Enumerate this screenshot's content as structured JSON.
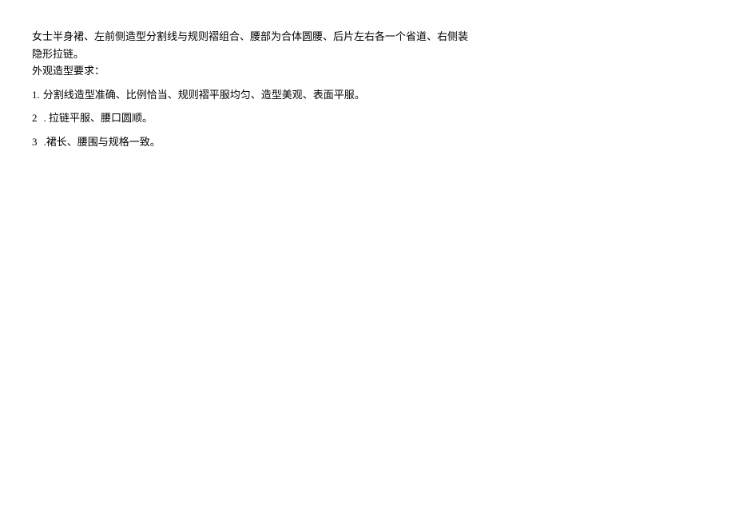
{
  "description": {
    "line1": "女士半身裙、左前侧造型分割线与规则褶组合、腰部为合体圆腰、后片左右各一个省道、右侧装",
    "line2": "隐形拉链。"
  },
  "requirements_title": "外观造型要求：",
  "requirements": [
    {
      "number": "1.",
      "text": "分割线造型准确、比例恰当、规则褶平服均匀、造型美观、表面平服。"
    },
    {
      "number": "2",
      "text": ". 拉链平服、腰口圆顺。"
    },
    {
      "number": "3",
      "text": ".裙长、腰围与规格一致。"
    }
  ]
}
